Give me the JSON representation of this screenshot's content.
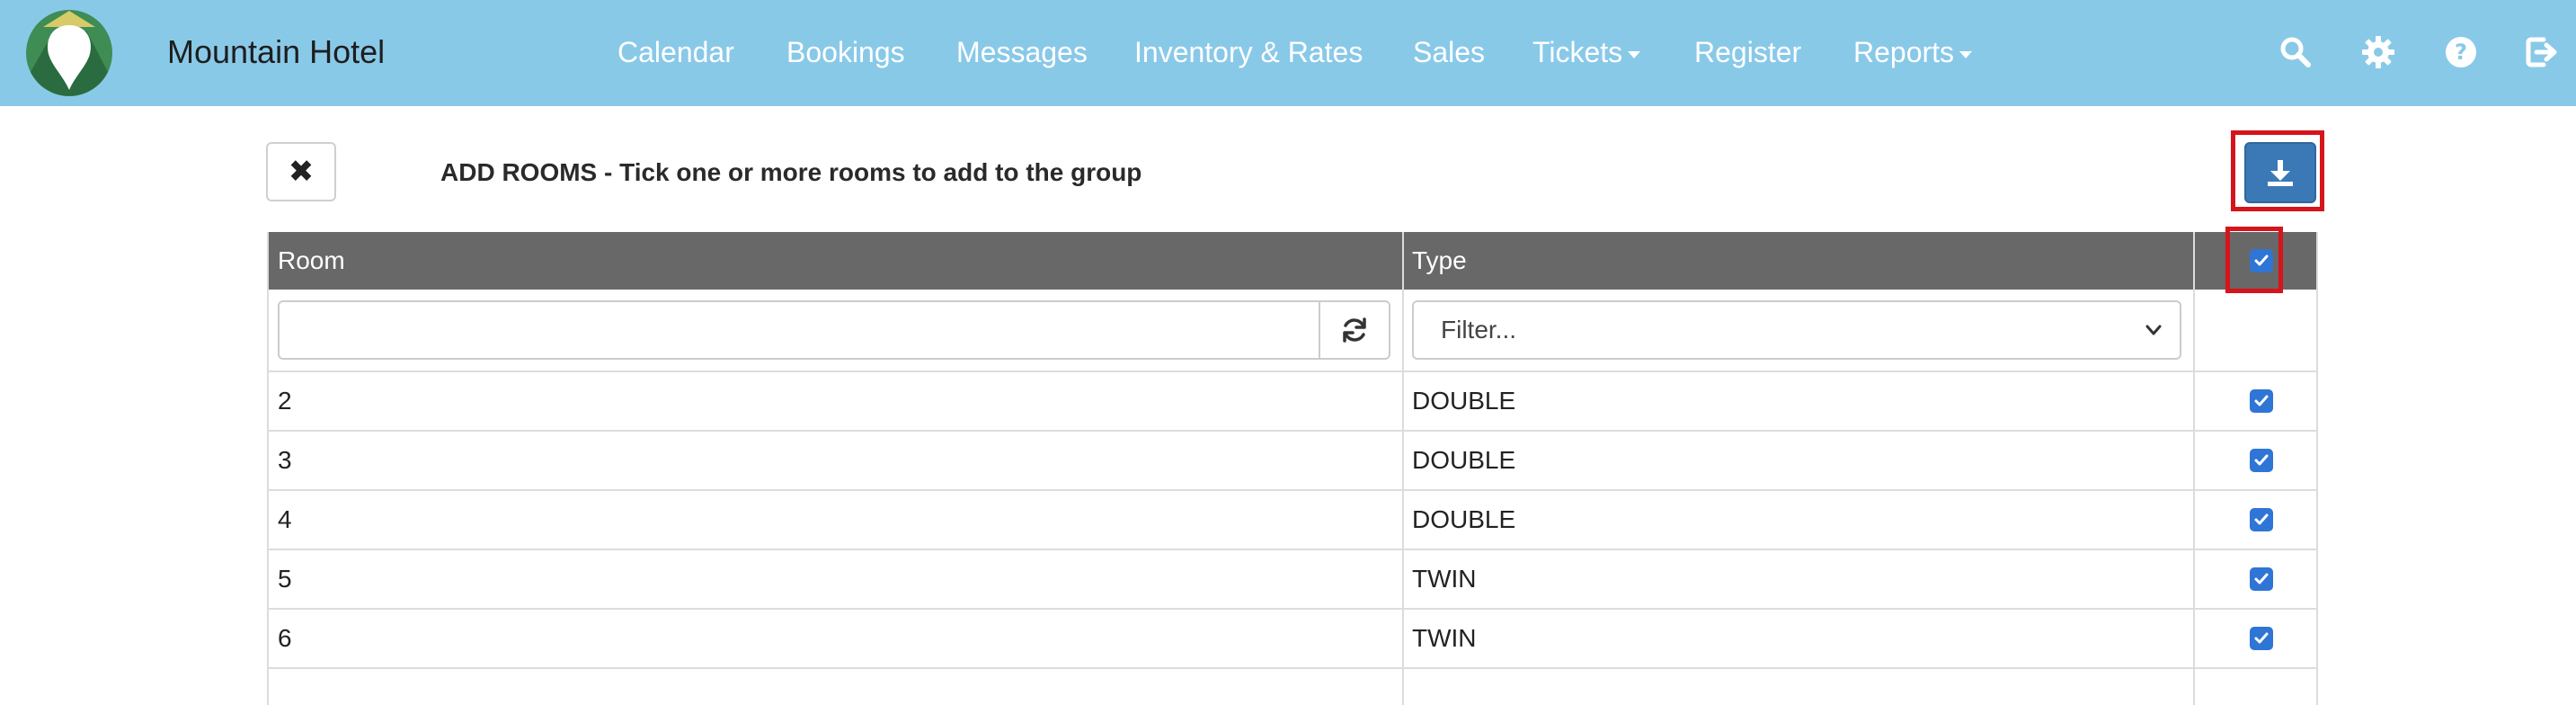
{
  "navbar": {
    "brand": "Mountain Hotel",
    "bg_color": "#89c9e8",
    "items": [
      {
        "label": "Calendar"
      },
      {
        "label": "Bookings"
      },
      {
        "label": "Messages"
      },
      {
        "label": "Inventory & Rates"
      },
      {
        "label": "Sales"
      },
      {
        "label": "Tickets",
        "dropdown": true
      },
      {
        "label": "Register"
      },
      {
        "label": "Reports",
        "dropdown": true
      }
    ],
    "icons": [
      "search-icon",
      "gear-icon",
      "help-icon",
      "logout-icon"
    ]
  },
  "panel": {
    "close_icon": "close-icon",
    "title": "ADD ROOMS - Tick one or more rooms to add to the group",
    "download_icon": "download-icon",
    "accent_color": "#3b78b6",
    "highlight_color": "#d6141b"
  },
  "table": {
    "headers": {
      "room": "Room",
      "type": "Type"
    },
    "select_all_checked": true,
    "filter": {
      "room_value": "",
      "type_placeholder": "Filter..."
    },
    "rows": [
      {
        "room": "2",
        "type": "DOUBLE",
        "checked": true
      },
      {
        "room": "3",
        "type": "DOUBLE",
        "checked": true
      },
      {
        "room": "4",
        "type": "DOUBLE",
        "checked": true
      },
      {
        "room": "5",
        "type": "TWIN",
        "checked": true
      },
      {
        "room": "6",
        "type": "TWIN",
        "checked": true
      }
    ]
  }
}
